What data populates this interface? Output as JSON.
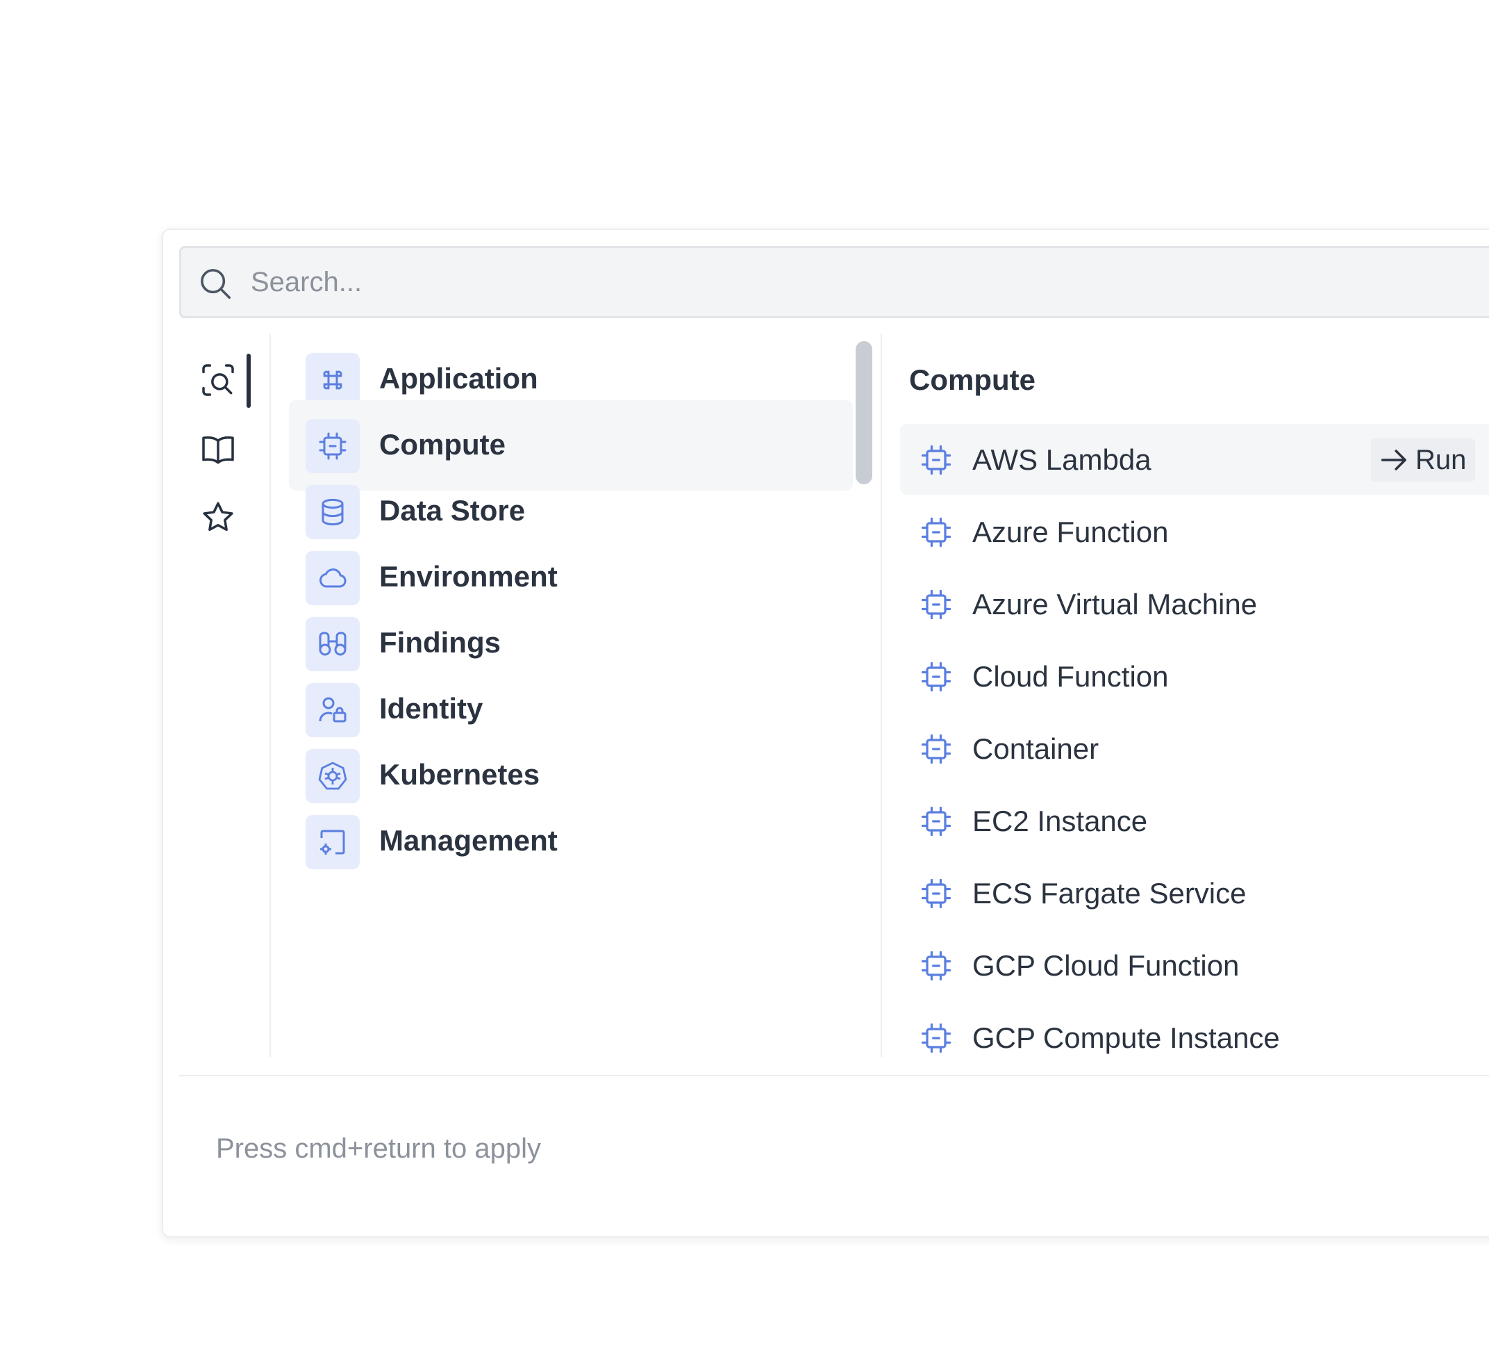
{
  "search": {
    "placeholder": "Search...",
    "value": ""
  },
  "rail": {
    "items": [
      {
        "name": "query-icon",
        "active": true
      },
      {
        "name": "book-icon",
        "active": false
      },
      {
        "name": "star-icon",
        "active": false
      }
    ]
  },
  "categories": {
    "items": [
      {
        "label": "Application",
        "icon": "command-icon"
      },
      {
        "label": "Compute",
        "icon": "cpu-icon",
        "active": true
      },
      {
        "label": "Data Store",
        "icon": "database-icon"
      },
      {
        "label": "Environment",
        "icon": "cloud-icon"
      },
      {
        "label": "Findings",
        "icon": "binoculars-icon"
      },
      {
        "label": "Identity",
        "icon": "user-lock-icon"
      },
      {
        "label": "Kubernetes",
        "icon": "kubernetes-icon"
      },
      {
        "label": "Management",
        "icon": "cast-settings-icon"
      }
    ]
  },
  "results": {
    "title": "Compute",
    "run_label": "Run",
    "items": [
      {
        "label": "AWS Lambda",
        "icon": "cpu-icon",
        "active": true
      },
      {
        "label": "Azure Function",
        "icon": "cpu-icon"
      },
      {
        "label": "Azure Virtual Machine",
        "icon": "cpu-icon"
      },
      {
        "label": "Cloud Function",
        "icon": "cpu-icon"
      },
      {
        "label": "Container",
        "icon": "cpu-icon"
      },
      {
        "label": "EC2 Instance",
        "icon": "cpu-icon"
      },
      {
        "label": "ECS Fargate Service",
        "icon": "cpu-icon"
      },
      {
        "label": "GCP Cloud Function",
        "icon": "cpu-icon"
      },
      {
        "label": "GCP Compute Instance",
        "icon": "cpu-icon"
      }
    ]
  },
  "footer": {
    "hint": "Press cmd+return to apply"
  },
  "colors": {
    "accent_icon": "#5b7fe0",
    "icon_bg": "#e6ecfb",
    "text": "#2b3340",
    "muted": "#8c929b"
  }
}
